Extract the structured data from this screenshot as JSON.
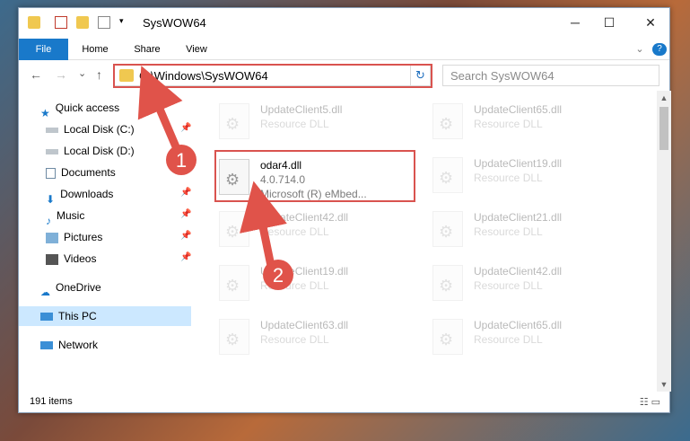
{
  "window": {
    "title": "SysWOW64",
    "controls": {
      "minimize": "─",
      "maximize": "☐",
      "close": "✕"
    }
  },
  "ribbon": {
    "tabs": [
      "File",
      "Home",
      "Share",
      "View"
    ],
    "expand": "⌄",
    "help": "?"
  },
  "address": {
    "back": "←",
    "forward": "→",
    "recent": "⌄",
    "up": "↑",
    "path": "C:\\Windows\\SysWOW64",
    "refresh": "↻",
    "search_placeholder": "Search SysWOW64"
  },
  "navpane": {
    "items": [
      {
        "label": "Quick access",
        "icon": "star-icon"
      },
      {
        "label": "Local Disk (C:)",
        "icon": "drive-icon",
        "pinned": "📌"
      },
      {
        "label": "Local Disk (D:)",
        "icon": "drive-icon"
      },
      {
        "label": "Documents",
        "icon": "documents-icon",
        "pinned": "📌"
      },
      {
        "label": "Downloads",
        "icon": "download-icon",
        "pinned": "📌"
      },
      {
        "label": "Music",
        "icon": "music-icon",
        "pinned": "📌"
      },
      {
        "label": "Pictures",
        "icon": "pictures-icon",
        "pinned": "📌"
      },
      {
        "label": "Videos",
        "icon": "videos-icon",
        "pinned": "📌"
      },
      {
        "label": "OneDrive",
        "icon": "cloud-icon"
      },
      {
        "label": "This PC",
        "icon": "computer-icon"
      },
      {
        "label": "Network",
        "icon": "network-icon"
      }
    ]
  },
  "files": {
    "left": [
      {
        "name": "UpdateClient5.dll",
        "type": "Resource DLL"
      },
      {
        "name": "odar4.dll",
        "type": "4.0.714.0",
        "desc": "Microsoft (R) eMbed..."
      },
      {
        "name": "UpdateClient42.dll",
        "type": "Resource DLL"
      },
      {
        "name": "UpdateClient19.dll",
        "type": "Resource DLL"
      },
      {
        "name": "UpdateClient63.dll",
        "type": "Resource DLL"
      }
    ],
    "right": [
      {
        "name": "UpdateClient65.dll",
        "type": "Resource DLL"
      },
      {
        "name": "UpdateClient19.dll",
        "type": "Resource DLL"
      },
      {
        "name": "UpdateClient21.dll",
        "type": "Resource DLL"
      },
      {
        "name": "UpdateClient42.dll",
        "type": "Resource DLL"
      },
      {
        "name": "UpdateClient65.dll",
        "type": "Resource DLL"
      }
    ]
  },
  "annotations": {
    "step1": "1",
    "step2": "2",
    "color": "#e0534a"
  },
  "status": {
    "count": "191 items"
  },
  "colors": {
    "accent": "#1979ca",
    "highlight": "#d9534f",
    "selected": "#cce8ff"
  }
}
